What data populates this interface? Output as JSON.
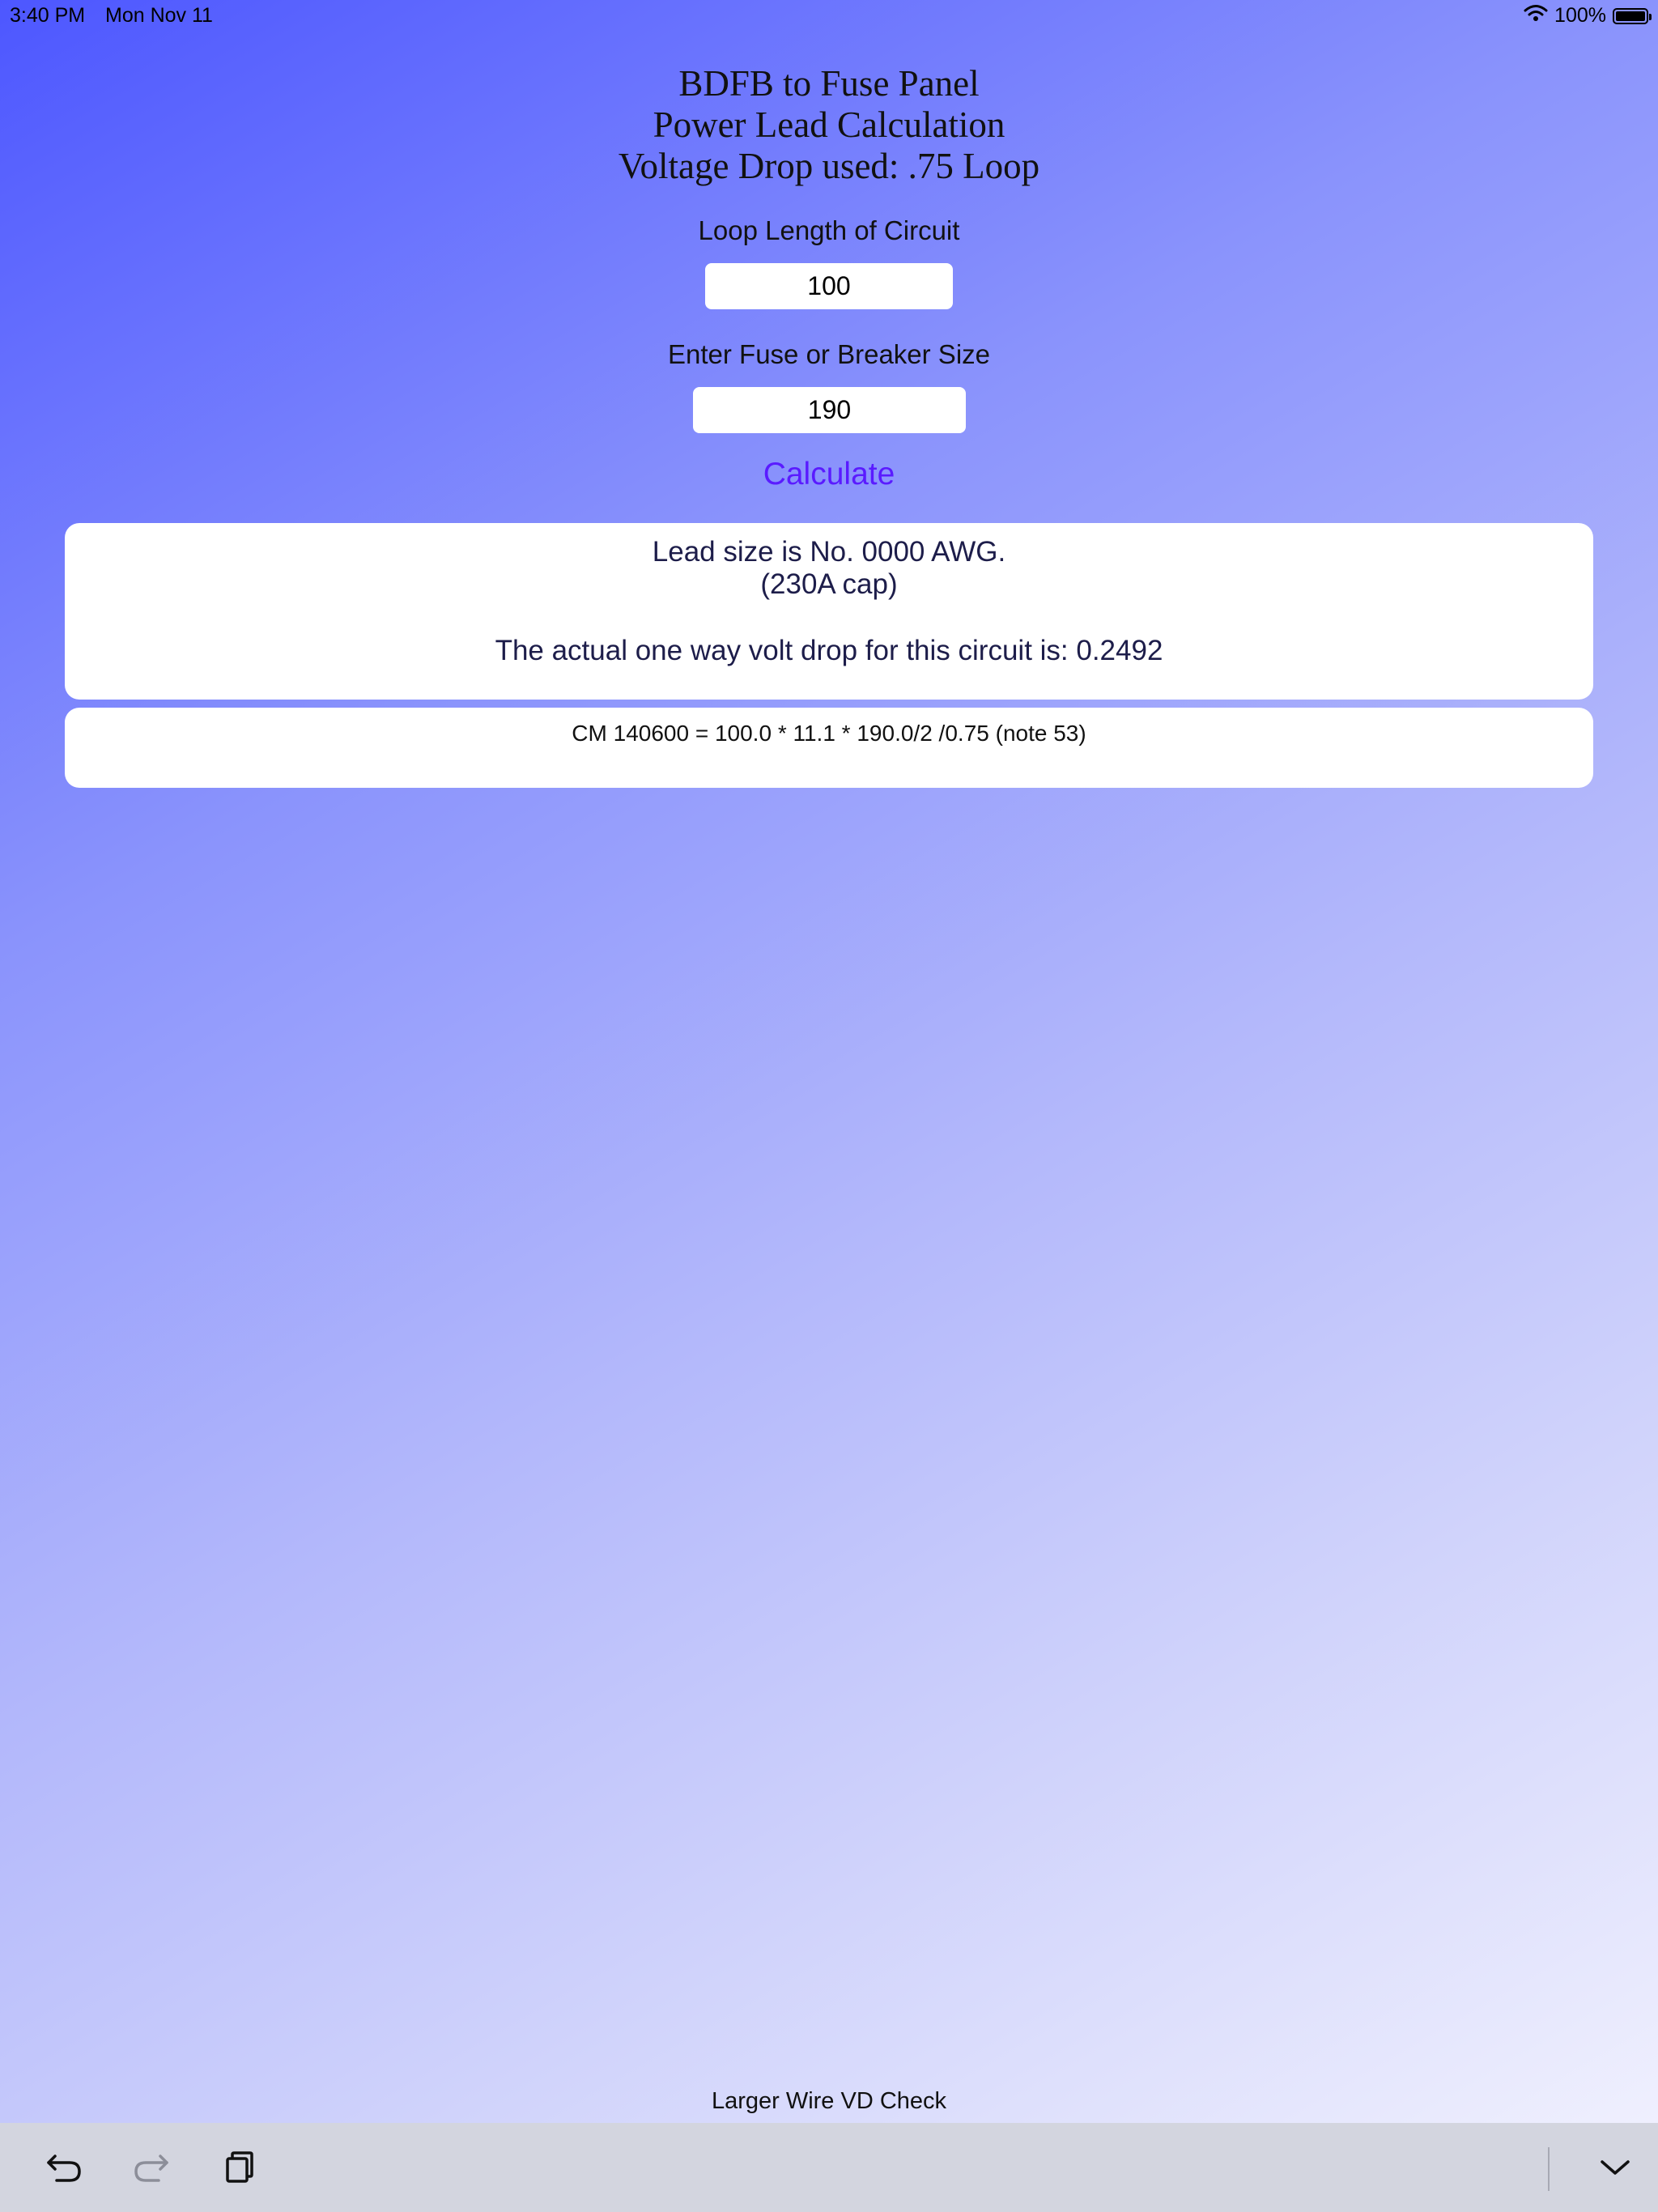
{
  "status_bar": {
    "time": "3:40 PM",
    "date": "Mon Nov 11",
    "battery_percent": "100%",
    "battery_level": 1.0
  },
  "header": {
    "line1": "BDFB to Fuse Panel",
    "line2": "Power Lead Calculation",
    "line3": "Voltage Drop used: .75 Loop"
  },
  "form": {
    "loop_length_label": "Loop Length of Circuit",
    "loop_length_value": "100",
    "fuse_label": "Enter Fuse or Breaker Size",
    "fuse_value": "190",
    "calculate_label": "Calculate"
  },
  "result": {
    "lead_size": "Lead size is No. 0000 AWG.",
    "capacity": "(230A cap)",
    "volt_drop": "The actual one way volt drop for this circuit is: 0.2492"
  },
  "formula": {
    "text": "CM 140600 = 100.0 * 11.1 * 190.0/2 /0.75 (note 53)"
  },
  "footer": {
    "larger_wire_label": "Larger Wire VD Check"
  },
  "toolbar": {
    "icons": [
      "undo-icon",
      "redo-icon",
      "paste-icon",
      "chevron-down-icon"
    ]
  },
  "colors": {
    "accent": "#5a1bff",
    "gradient_start": "#4d57ff",
    "gradient_end": "#f3f3fe",
    "toolbar_bg": "#d3d5df"
  }
}
